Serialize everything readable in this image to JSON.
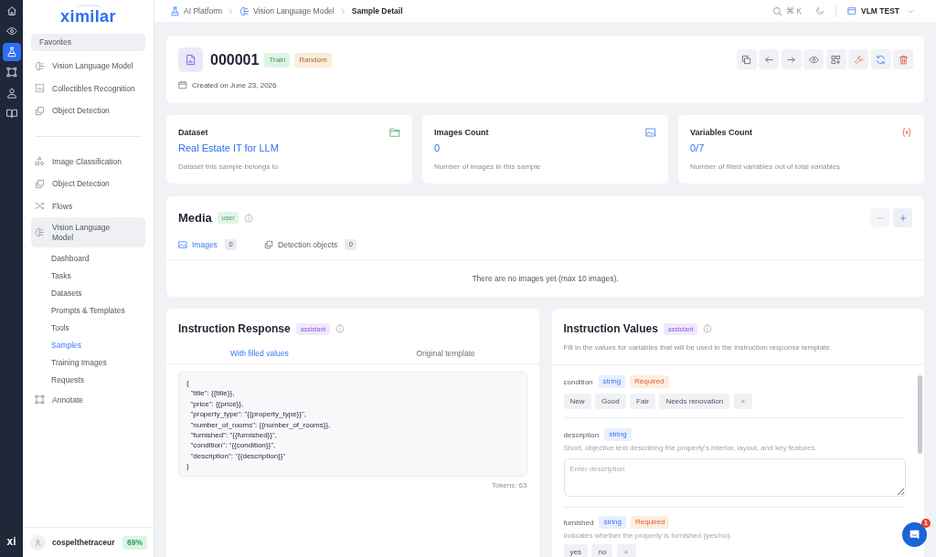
{
  "rail": {
    "items": [
      {
        "selected": false
      },
      {
        "selected": false
      },
      {
        "selected": true
      },
      {
        "selected": false
      },
      {
        "selected": false
      },
      {
        "selected": false
      }
    ],
    "logo": "xi"
  },
  "sidebar": {
    "logo": "ximilar",
    "favorites": {
      "title": "Favorites",
      "items": [
        {
          "label": "Vision Language Model",
          "selected": false
        },
        {
          "label": "Collectibles Recognition",
          "selected": false
        },
        {
          "label": "Object Detection",
          "selected": false
        }
      ]
    },
    "items": [
      {
        "label": "Image Classification",
        "selected": false
      },
      {
        "label": "Object Detection",
        "selected": false
      },
      {
        "label": "Flows",
        "selected": false
      },
      {
        "label": "Vision Language Model",
        "selected": true,
        "children": [
          {
            "label": "Dashboard",
            "selected": false
          },
          {
            "label": "Tasks",
            "selected": false
          },
          {
            "label": "Datasets",
            "selected": false
          },
          {
            "label": "Prompts & Templates",
            "selected": false
          },
          {
            "label": "Tools",
            "selected": false
          },
          {
            "label": "Samples",
            "selected": true
          },
          {
            "label": "Training Images",
            "selected": false
          },
          {
            "label": "Requests",
            "selected": false
          }
        ]
      },
      {
        "label": "Annotate",
        "selected": false
      }
    ],
    "user": {
      "name": "cospelthetraceur",
      "usage": "69%"
    }
  },
  "topbar": {
    "breadcrumbs": [
      {
        "label": "AI Platform",
        "current": false
      },
      {
        "label": "Vision Language Model",
        "current": false
      },
      {
        "label": "Sample Detail",
        "current": true
      }
    ],
    "search_shortcut": "⌘ K",
    "workspace": "VLM TEST"
  },
  "sample": {
    "id": "000001",
    "tags": [
      {
        "label": "Train",
        "color": "#dcf5e4"
      },
      {
        "label": "Random",
        "color": "#fcecd8"
      }
    ],
    "created": "Created on June 23, 2026"
  },
  "stats": [
    {
      "title": "Dataset",
      "value": "Real Estate IT for LLM",
      "description": "Dataset this sample belongs to"
    },
    {
      "title": "Images Count",
      "value": "0",
      "description": "Number of images in this sample"
    },
    {
      "title": "Variables Count",
      "value": "0/7",
      "description": "Number of filled variables out of total variables"
    }
  ],
  "media": {
    "title": "Media",
    "role": "user",
    "actions": [
      {
        "disabled": true
      },
      {
        "disabled": false
      }
    ],
    "tabs": [
      {
        "label": "Images",
        "count": "0",
        "selected": true
      },
      {
        "label": "Detection objects",
        "count": "0",
        "selected": false
      }
    ],
    "empty_message": "There are no images yet (max 10 images)."
  },
  "instruction_response": {
    "title": "Instruction Response",
    "role": "assistant",
    "tabs": [
      {
        "label": "With filled values",
        "selected": true
      },
      {
        "label": "Original template",
        "selected": false
      }
    ],
    "template": "{\n  \"title\": {{title}},\n  \"price\": {{price}},\n  \"property_type\": \"{{property_type}}\",\n  \"number_of_rooms\": {{number_of_rooms}},\n  \"furnished\": \"{{furnished}}\",\n  \"condition\": \"{{condition}}\",\n  \"description\": \"{{description}}\"\n}",
    "tokens": "Tokens: 63"
  },
  "instruction_values": {
    "title": "Instruction Values",
    "role": "assistant",
    "description": "Fill in the values for variables that will be used in the instruction response template.",
    "variables": [
      {
        "kind": "choice",
        "name": "condition",
        "type": "string",
        "required_label": "Required",
        "options": [
          {
            "label": "New",
            "selected": false
          },
          {
            "label": "Good",
            "selected": false
          },
          {
            "label": "Fair",
            "selected": false
          },
          {
            "label": "Needs renovation",
            "selected": false
          }
        ],
        "clear": "×"
      },
      {
        "kind": "text",
        "name": "description",
        "type": "string",
        "hint": "Short, objective text describing the property's interior, layout, and key features.",
        "placeholder": "Enter description"
      },
      {
        "kind": "choice",
        "name": "furnished",
        "type": "string",
        "required_label": "Required",
        "hint": "Indicates whether the property is furnished (yes/no).",
        "options": [
          {
            "label": "yes",
            "selected": false
          },
          {
            "label": "no",
            "selected": false
          }
        ],
        "clear": "×"
      }
    ]
  },
  "chat_widget": {
    "unread": "1"
  }
}
